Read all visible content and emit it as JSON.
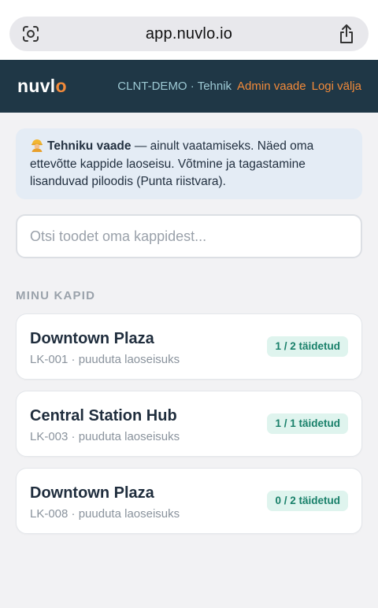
{
  "browser": {
    "url": "app.nuvlo.io",
    "left_icon": "lens-icon",
    "right_icon": "share-icon"
  },
  "header": {
    "logo_main": "nuvl",
    "logo_accent": "o",
    "org": "CLNT-DEMO",
    "separator": "·",
    "role": "Tehnik",
    "admin_link": "Admin vaade",
    "logout_link": "Logi välja",
    "colors": {
      "background": "#1f3746",
      "accent": "#f28a3a",
      "org_text": "#9dc9d4"
    }
  },
  "banner": {
    "icon": "construction-worker-icon",
    "title": "Tehniku vaade",
    "text": " — ainult vaatamiseks. Näed oma ettevõtte kappide laoseisu. Võtmine ja tagastamine lisanduvad piloodis (Punta riistvara)."
  },
  "search": {
    "placeholder": "Otsi toodet oma kappidest..."
  },
  "section": {
    "title": "MINU KAPID"
  },
  "cabinets": [
    {
      "name": "Downtown Plaza",
      "code": "LK-001",
      "status": "puuduta laoseisuks",
      "badge": "1 / 2 täidetud"
    },
    {
      "name": "Central Station Hub",
      "code": "LK-003",
      "status": "puuduta laoseisuks",
      "badge": "1 / 1 täidetud"
    },
    {
      "name": "Downtown Plaza",
      "code": "LK-008",
      "status": "puuduta laoseisuks",
      "badge": "0 / 2 täidetud"
    }
  ]
}
